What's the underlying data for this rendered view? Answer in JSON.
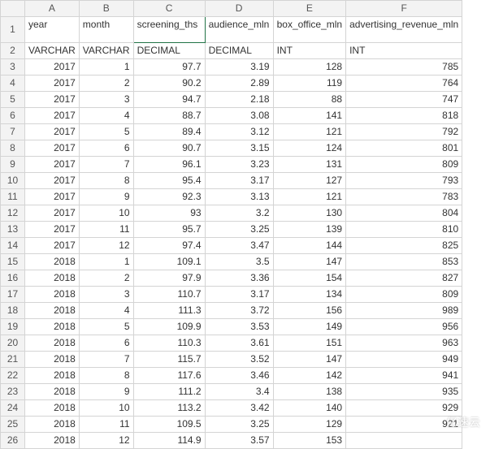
{
  "columns": [
    "A",
    "B",
    "C",
    "D",
    "E",
    "F"
  ],
  "row_numbers": [
    1,
    2,
    3,
    4,
    5,
    6,
    7,
    8,
    9,
    10,
    11,
    12,
    13,
    14,
    15,
    16,
    17,
    18,
    19,
    20,
    21,
    22,
    23,
    24,
    25,
    26
  ],
  "header_row": {
    "A": "year",
    "B": "month",
    "C": "screening_ths",
    "D": "audience_mln",
    "E": "box_office_mln",
    "F": "advertising_revenue_mln"
  },
  "type_row": {
    "A": "VARCHAR",
    "B": "VARCHAR",
    "C": "DECIMAL",
    "D": "DECIMAL",
    "E": "INT",
    "F": "INT"
  },
  "data_rows": [
    {
      "A": "2017",
      "B": "1",
      "C": "97.7",
      "D": "3.19",
      "E": "128",
      "F": "785"
    },
    {
      "A": "2017",
      "B": "2",
      "C": "90.2",
      "D": "2.89",
      "E": "119",
      "F": "764"
    },
    {
      "A": "2017",
      "B": "3",
      "C": "94.7",
      "D": "2.18",
      "E": "88",
      "F": "747"
    },
    {
      "A": "2017",
      "B": "4",
      "C": "88.7",
      "D": "3.08",
      "E": "141",
      "F": "818"
    },
    {
      "A": "2017",
      "B": "5",
      "C": "89.4",
      "D": "3.12",
      "E": "121",
      "F": "792"
    },
    {
      "A": "2017",
      "B": "6",
      "C": "90.7",
      "D": "3.15",
      "E": "124",
      "F": "801"
    },
    {
      "A": "2017",
      "B": "7",
      "C": "96.1",
      "D": "3.23",
      "E": "131",
      "F": "809"
    },
    {
      "A": "2017",
      "B": "8",
      "C": "95.4",
      "D": "3.17",
      "E": "127",
      "F": "793"
    },
    {
      "A": "2017",
      "B": "9",
      "C": "92.3",
      "D": "3.13",
      "E": "121",
      "F": "783"
    },
    {
      "A": "2017",
      "B": "10",
      "C": "93",
      "D": "3.2",
      "E": "130",
      "F": "804"
    },
    {
      "A": "2017",
      "B": "11",
      "C": "95.7",
      "D": "3.25",
      "E": "139",
      "F": "810"
    },
    {
      "A": "2017",
      "B": "12",
      "C": "97.4",
      "D": "3.47",
      "E": "144",
      "F": "825"
    },
    {
      "A": "2018",
      "B": "1",
      "C": "109.1",
      "D": "3.5",
      "E": "147",
      "F": "853"
    },
    {
      "A": "2018",
      "B": "2",
      "C": "97.9",
      "D": "3.36",
      "E": "154",
      "F": "827"
    },
    {
      "A": "2018",
      "B": "3",
      "C": "110.7",
      "D": "3.17",
      "E": "134",
      "F": "809"
    },
    {
      "A": "2018",
      "B": "4",
      "C": "111.3",
      "D": "3.72",
      "E": "156",
      "F": "989"
    },
    {
      "A": "2018",
      "B": "5",
      "C": "109.9",
      "D": "3.53",
      "E": "149",
      "F": "956"
    },
    {
      "A": "2018",
      "B": "6",
      "C": "110.3",
      "D": "3.61",
      "E": "151",
      "F": "963"
    },
    {
      "A": "2018",
      "B": "7",
      "C": "115.7",
      "D": "3.52",
      "E": "147",
      "F": "949"
    },
    {
      "A": "2018",
      "B": "8",
      "C": "117.6",
      "D": "3.46",
      "E": "142",
      "F": "941"
    },
    {
      "A": "2018",
      "B": "9",
      "C": "111.2",
      "D": "3.4",
      "E": "138",
      "F": "935"
    },
    {
      "A": "2018",
      "B": "10",
      "C": "113.2",
      "D": "3.42",
      "E": "140",
      "F": "929"
    },
    {
      "A": "2018",
      "B": "11",
      "C": "109.5",
      "D": "3.25",
      "E": "129",
      "F": "921"
    },
    {
      "A": "2018",
      "B": "12",
      "C": "114.9",
      "D": "3.57",
      "E": "153",
      "F": ""
    }
  ],
  "selected_cell": "C1",
  "watermark": "亿速云"
}
